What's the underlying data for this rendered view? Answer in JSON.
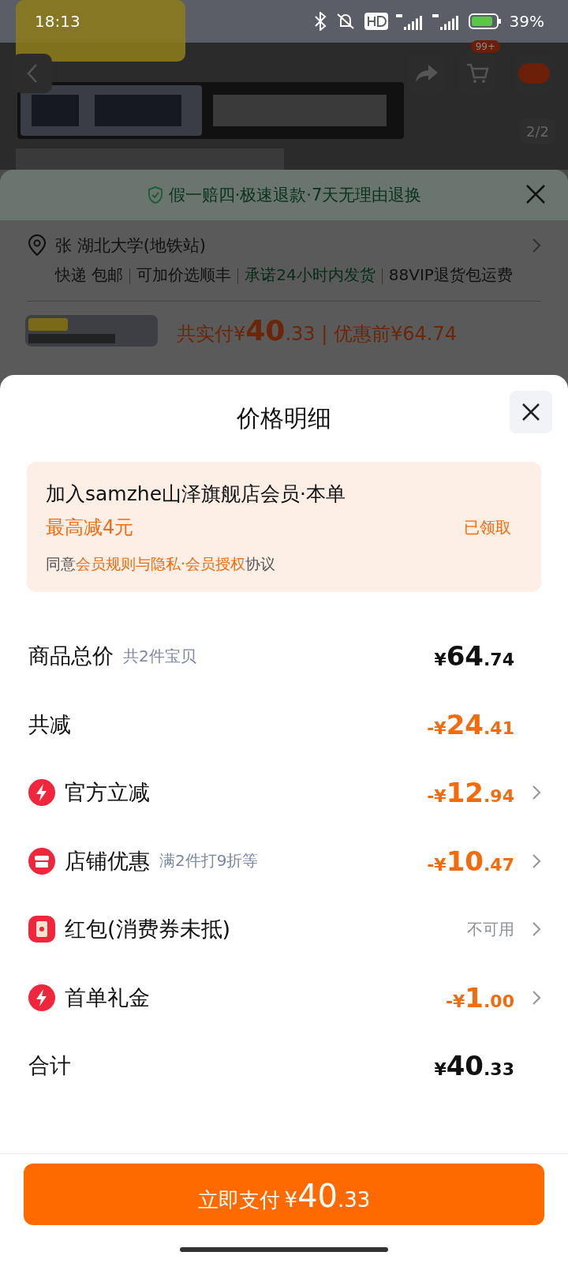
{
  "status_bar": {
    "time": "18:13",
    "battery": "39%"
  },
  "product_gallery": {
    "kind": "picture",
    "page_indicator": "2/2",
    "cart_badge": "99+"
  },
  "order_sheet": {
    "guarantee": "假一赔四·极速退款·7天无理由退换",
    "address": "张 湖北大学(地铁站)",
    "delivery": [
      {
        "text": "快递 包邮",
        "highlight": false
      },
      {
        "text": "可加价选顺丰",
        "highlight": false
      },
      {
        "text": "承诺24小时内发货",
        "highlight": true
      },
      {
        "text": "88VIP退货包运费",
        "highlight": false
      }
    ],
    "price_summary": {
      "prefix": "共实付¥",
      "integer": "40",
      "decimal": ".33",
      "separator": "|",
      "before": "优惠前¥64.74"
    }
  },
  "price_detail": {
    "title": "价格明细",
    "membership": {
      "title": "加入samzhe山泽旗舰店会员·本单",
      "benefit": "最高减4元",
      "status": "已领取",
      "agreement_prefix": "同意",
      "agreement_link": "会员规则与隐私·会员授权",
      "agreement_suffix": "协议"
    },
    "rows": [
      {
        "kind": "subtotal",
        "label": "商品总价",
        "note": "共2件宝贝",
        "arrow": false,
        "amount": {
          "sign": "¥",
          "integer": "64",
          "decimal": ".74"
        }
      },
      {
        "kind": "saving",
        "label": "共减",
        "arrow": false,
        "amount": {
          "sign": "-¥",
          "integer": "24",
          "decimal": ".41"
        }
      },
      {
        "kind": "instant",
        "label": "官方立减",
        "arrow": true,
        "amount": {
          "sign": "-¥",
          "integer": "12",
          "decimal": ".94"
        }
      },
      {
        "kind": "store",
        "label": "店铺优惠",
        "note": "满2件打9折等",
        "arrow": true,
        "amount": {
          "sign": "-¥",
          "integer": "10",
          "decimal": ".47"
        }
      },
      {
        "kind": "coupon",
        "label": "红包(消费券未抵)",
        "arrow": true,
        "text": "不可用"
      },
      {
        "kind": "gift",
        "label": "首单礼金",
        "arrow": true,
        "amount": {
          "sign": "-¥",
          "integer": "1",
          "decimal": ".00"
        }
      },
      {
        "kind": "total",
        "label": "合计",
        "arrow": false,
        "amount": {
          "sign": "¥",
          "integer": "40",
          "decimal": ".33"
        }
      }
    ],
    "pay_button": {
      "label": "立即支付",
      "amount": {
        "sign": "¥",
        "integer": "40",
        "decimal": ".33"
      }
    }
  }
}
